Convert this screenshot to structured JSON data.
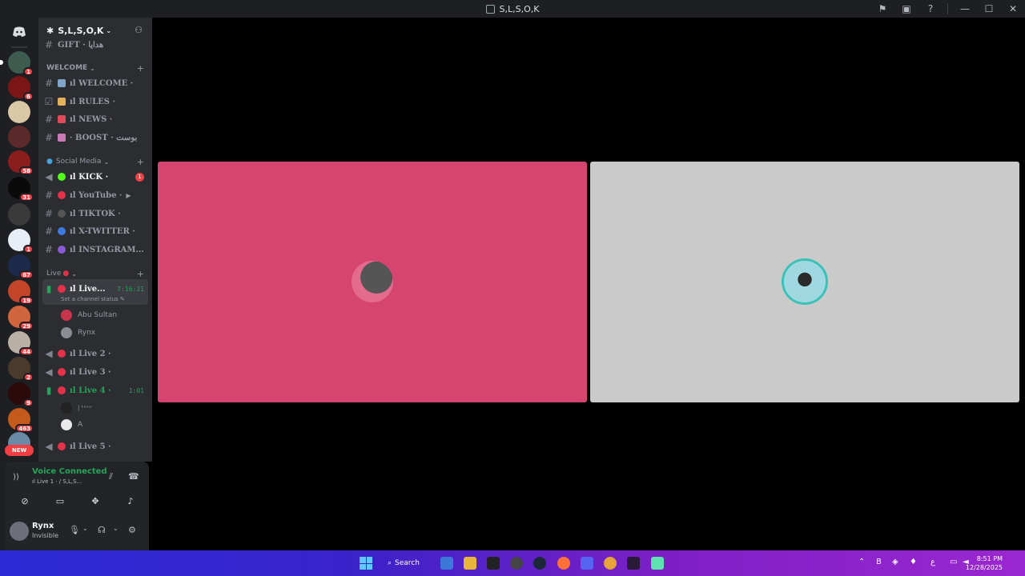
{
  "window": {
    "title": "S,L,S,O,K"
  },
  "colors": {
    "accent_green": "#23a55a",
    "mention_red": "#f23f43",
    "tile1_bg": "#d64570",
    "tile2_bg": "#cacaca"
  },
  "rail": {
    "badges": [
      "1",
      "6",
      "",
      "",
      "58",
      "31",
      "",
      "1",
      "67",
      "19",
      "29",
      "44",
      "2",
      "9",
      "463"
    ],
    "new_label": "NEW"
  },
  "guild": {
    "name": "S,L,S,O,K"
  },
  "channels": {
    "gift": "GIFT · هدايا",
    "cat_welcome": "WELCOME",
    "welcome": "ıl WELCOME ·",
    "rules": "ıl RULES ·",
    "news": "ıl NEWS ·",
    "boost": "· BOOST · بوست",
    "cat_social": "Social Media",
    "kick": "ıl KICK ·",
    "kick_mentions": "1",
    "youtube": "ıl YouTube ·",
    "tiktok": "ıl TIKTOK ·",
    "xtwitter": "ıl X-TWITTER ·",
    "instagram": "ıl INSTAGRAM...",
    "cat_live": "Live",
    "live1": "ıl Live...",
    "live1_timer": "7:16:21",
    "live1_status": "Set a channel status",
    "member1": "Abu Sultan",
    "member2": "Rynx",
    "live2": "ıl Live 2 ·",
    "live3": "ıl Live 3 ·",
    "live4": "ıl Live 4 ·",
    "live4_timer": "1:01",
    "member3": "| ᵏᵒᵐᵒ",
    "member4": "A",
    "live5": "ıl Live 5 ·"
  },
  "voice": {
    "title": "Voice Connected",
    "subtitle": "ıl Live 1 · / S,L,S..."
  },
  "user": {
    "name": "Rynx",
    "status": "Invisible"
  },
  "taskbar": {
    "search_label": "Search",
    "time": "8:51 PM",
    "date": "12/28/2025",
    "lang": "ع"
  }
}
